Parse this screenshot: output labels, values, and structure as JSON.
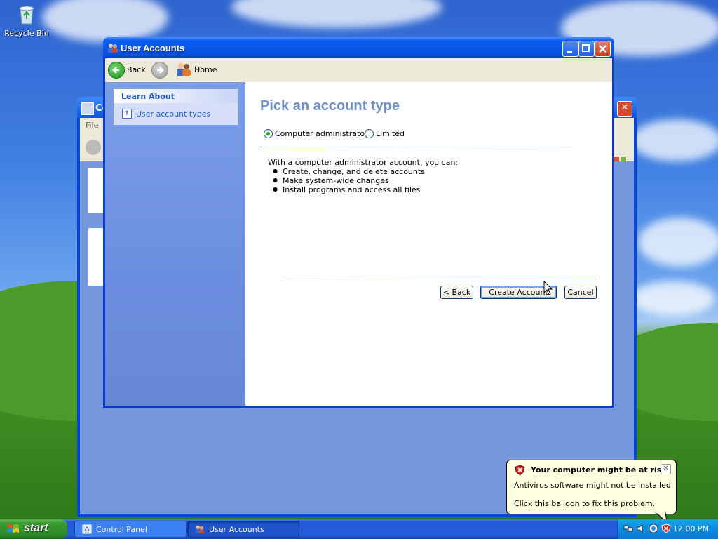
{
  "desktop": {
    "recycle_bin_label": "Recycle Bin"
  },
  "background_window": {
    "title_partial": "Co",
    "menu_partial": "File",
    "close_glyph": "✕"
  },
  "window": {
    "title": "User Accounts",
    "toolbar": {
      "back_label": "Back",
      "home_label": "Home"
    },
    "left_pane": {
      "section_title": "Learn About",
      "items": [
        {
          "label": "User account types",
          "icon": "help-icon"
        }
      ]
    },
    "content": {
      "heading": "Pick an account type",
      "options": [
        {
          "label": "Computer administrator",
          "selected": true
        },
        {
          "label": "Limited",
          "selected": false
        }
      ],
      "description": "With a computer administrator account, you can:",
      "bullets": [
        "Create, change, and delete accounts",
        "Make system-wide changes",
        "Install programs and access all files"
      ],
      "buttons": {
        "back": "< Back",
        "create": "Create Account",
        "cancel": "Cancel"
      }
    },
    "accent_color": "#0a50e0"
  },
  "taskbar": {
    "start_label": "start",
    "buttons": [
      {
        "label": "Control Panel",
        "active": false
      },
      {
        "label": "User Accounts",
        "active": true
      }
    ],
    "clock": "12:00 PM"
  },
  "balloon": {
    "title": "Your computer might be at risk",
    "line1": "Antivirus software might not be installed",
    "line2": "Click this balloon to fix this problem.",
    "close_glyph": "✕"
  }
}
